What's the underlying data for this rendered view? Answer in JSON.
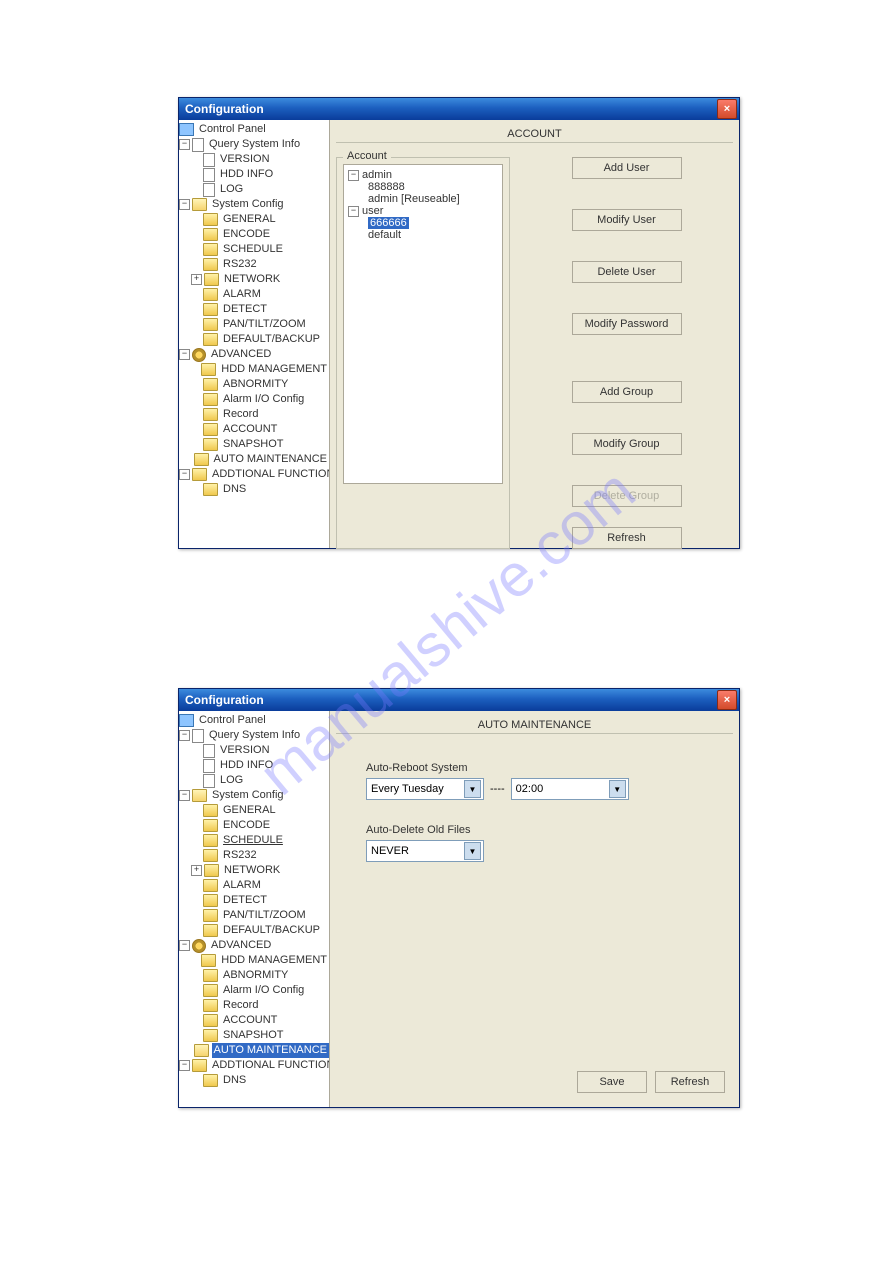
{
  "watermark": "manualshive.com",
  "window_title": "Configuration",
  "close_glyph": "×",
  "tree": {
    "root": "Control Panel",
    "querySysInfo": "Query System Info",
    "version": "VERSION",
    "hddInfo": "HDD INFO",
    "log": "LOG",
    "systemConfig": "System Config",
    "general": "GENERAL",
    "encode": "ENCODE",
    "schedule": "SCHEDULE",
    "rs232": "RS232",
    "network": "NETWORK",
    "alarm": "ALARM",
    "detect": "DETECT",
    "ptz": "PAN/TILT/ZOOM",
    "defaultBackup": "DEFAULT/BACKUP",
    "advanced": "ADVANCED",
    "hddMgmt": "HDD MANAGEMENT",
    "abnormity": "ABNORMITY",
    "alarmIo": "Alarm I/O Config",
    "record": "Record",
    "account": "ACCOUNT",
    "snapshot": "SNAPSHOT",
    "autoMaint": "AUTO MAINTENANCE",
    "addlFunc": "ADDTIONAL FUNCTION",
    "dns": "DNS"
  },
  "account_panel": {
    "title": "ACCOUNT",
    "group_legend": "Account",
    "tree_admin": "admin",
    "tree_888888": "888888",
    "tree_adminReusable": "admin [Reuseable]",
    "tree_user": "user",
    "tree_666666": "666666",
    "tree_default": "default",
    "buttons": {
      "addUser": "Add User",
      "modifyUser": "Modify User",
      "deleteUser": "Delete User",
      "modifyPw": "Modify Password",
      "addGroup": "Add Group",
      "modifyGroup": "Modify Group",
      "deleteGroup": "Delete Group",
      "refresh": "Refresh"
    }
  },
  "maint_panel": {
    "title": "AUTO MAINTENANCE",
    "autoRebootLabel": "Auto-Reboot System",
    "autoRebootDay": "Every Tuesday",
    "autoRebootTime": "02:00",
    "dashes": "----",
    "autoDeleteLabel": "Auto-Delete Old Files",
    "autoDeleteValue": "NEVER",
    "save": "Save",
    "refresh": "Refresh"
  }
}
